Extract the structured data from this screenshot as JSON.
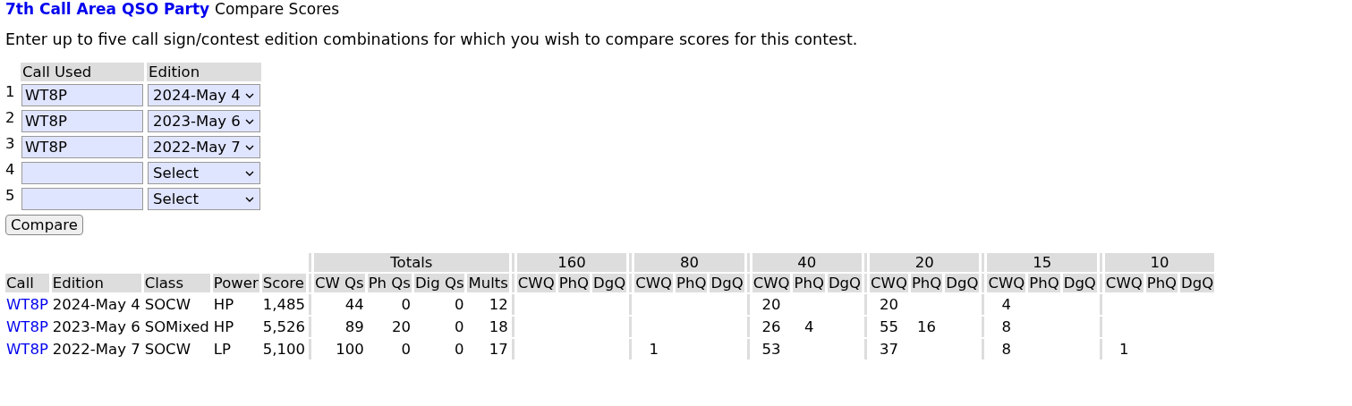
{
  "title": {
    "contest": "7th Call Area QSO Party",
    "page": "Compare Scores"
  },
  "intro": "Enter up to five call sign/contest edition combinations for which you wish to compare scores for this contest.",
  "form": {
    "columns": [
      "Call Used",
      "Edition"
    ],
    "rows": [
      {
        "number": "1",
        "call": "WT8P",
        "edition": "2024-May 4"
      },
      {
        "number": "2",
        "call": "WT8P",
        "edition": "2023-May 6"
      },
      {
        "number": "3",
        "call": "WT8P",
        "edition": "2022-May 7"
      },
      {
        "number": "4",
        "edition": "Select"
      },
      {
        "number": "5",
        "edition": "Select"
      }
    ],
    "button": "Compare"
  },
  "results": {
    "columns": [
      "Call",
      "Edition",
      "Class",
      "Power",
      "Score"
    ],
    "totals": {
      "title": "Totals",
      "columns": [
        "CW Qs",
        "Ph Qs",
        "Dig Qs",
        "Mults"
      ]
    },
    "bands": [
      {
        "name": "160",
        "columns": [
          "CWQ",
          "PhQ",
          "DgQ"
        ]
      },
      {
        "name": "80",
        "columns": [
          "CWQ",
          "PhQ",
          "DgQ"
        ]
      },
      {
        "name": "40",
        "columns": [
          "CWQ",
          "PhQ",
          "DgQ"
        ]
      },
      {
        "name": "20",
        "columns": [
          "CWQ",
          "PhQ",
          "DgQ"
        ]
      },
      {
        "name": "15",
        "columns": [
          "CWQ",
          "PhQ",
          "DgQ"
        ]
      },
      {
        "name": "10",
        "columns": [
          "CWQ",
          "PhQ",
          "DgQ"
        ]
      }
    ],
    "rows": [
      {
        "call": "WT8P",
        "edition": "2024-May 4",
        "class": "SOCW",
        "power": "HP",
        "score": "1,485",
        "totals": [
          "44",
          "0",
          "0",
          "12"
        ],
        "cwq_40": "20",
        "cwq_20": "20",
        "cwq_15": "4"
      },
      {
        "call": "WT8P",
        "edition": "2023-May 6",
        "class": "SOMixed",
        "power": "HP",
        "score": "5,526",
        "totals": [
          "89",
          "20",
          "0",
          "18"
        ],
        "cwq_40": "26",
        "phq_40": "4",
        "cwq_20": "55",
        "phq_20": "16",
        "cwq_15": "8"
      },
      {
        "call": "WT8P",
        "edition": "2022-May 7",
        "class": "SOCW",
        "power": "LP",
        "score": "5,100",
        "totals": [
          "100",
          "0",
          "0",
          "17"
        ],
        "cwq_80": "1",
        "cwq_40": "53",
        "cwq_20": "37",
        "cwq_15": "8",
        "cwq_10": "1"
      }
    ]
  }
}
